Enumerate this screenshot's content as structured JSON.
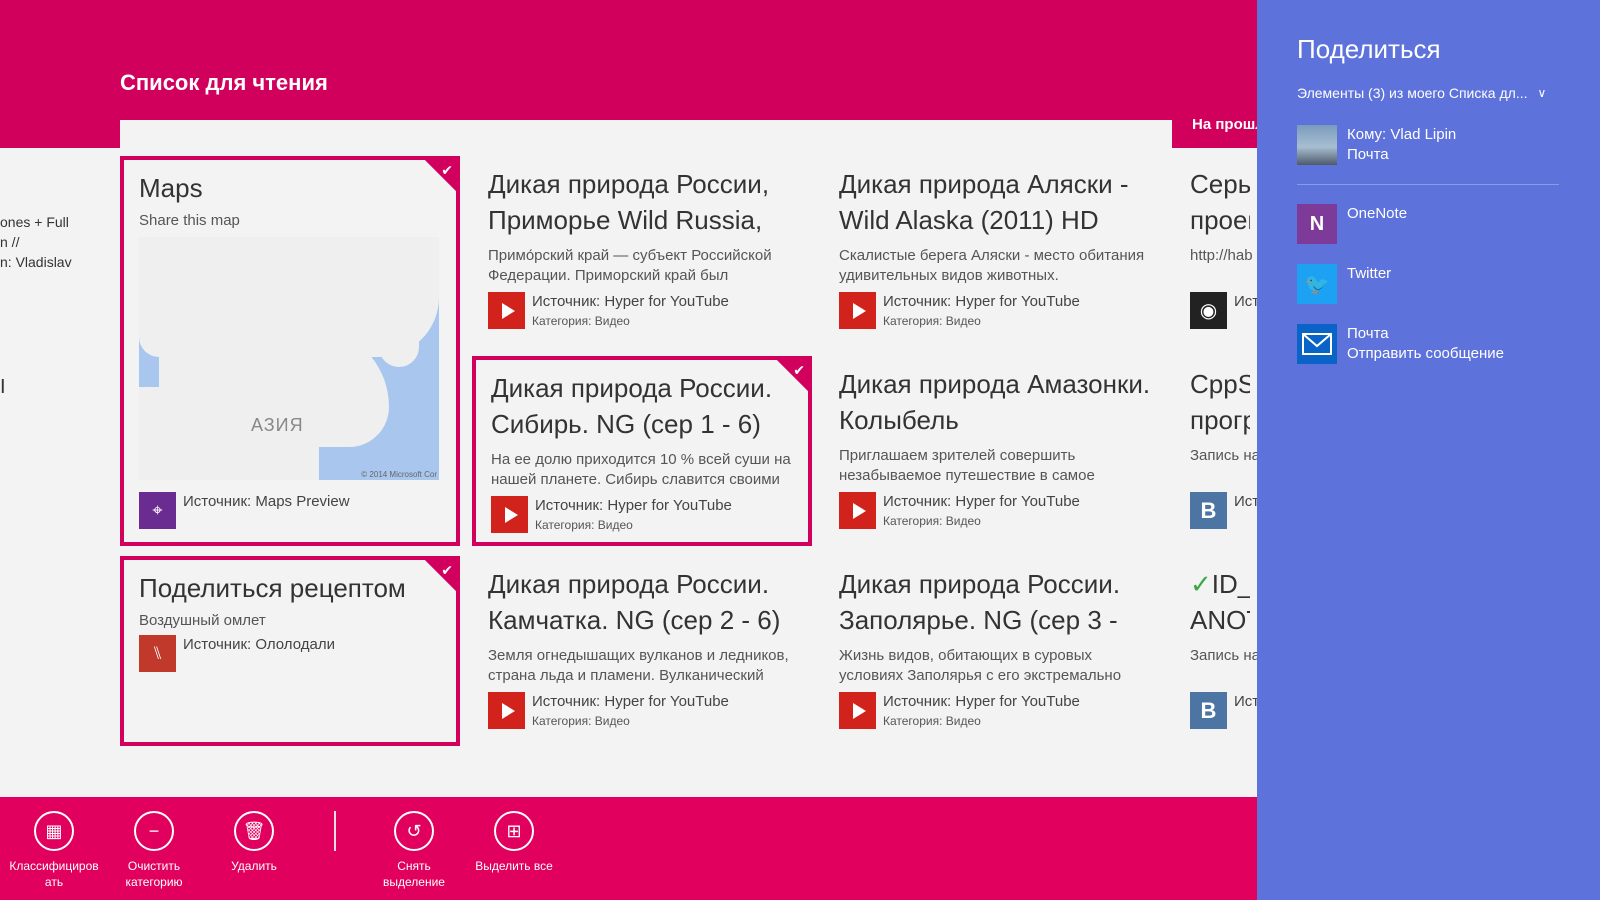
{
  "app": {
    "title": "Список для чтения",
    "section_label": "На прошлой неделе",
    "left_peek": [
      "ones + Full",
      "n //",
      "n: Vladislav"
    ],
    "left_peek_mark": "I"
  },
  "tiles": {
    "maps": {
      "title": "Maps",
      "subtitle": "Share this map",
      "map_label": "АЗИЯ",
      "map_copyright": "© 2014 Microsoft Cor",
      "source": "Источник: Maps Preview"
    },
    "recipe": {
      "title": "Поделиться рецептом",
      "subtitle": "Воздушный омлет",
      "source": "Источник: Ололодали"
    },
    "primorye": {
      "title": "Дикая природа России, Приморье  Wild Russia,",
      "desc": "Примо́рский край — субъект Российской Федерации. Приморский край был",
      "source": "Источник: Hyper for YouTube",
      "category": "Категория: Видео"
    },
    "siberia": {
      "title": "Дикая природа России. Сибирь. NG (сер 1 - 6)",
      "desc": "На ее долю приходится 10 % всей суши на нашей планете. Сибирь славится своими",
      "source": "Источник: Hyper for YouTube",
      "category": "Категория: Видео"
    },
    "kamchatka": {
      "title": "Дикая природа России. Камчатка. NG (сер 2 - 6)",
      "desc": "Земля огнедышащих вулканов и ледников, страна льда и пламени. Вулканический",
      "source": "Источник: Hyper for YouTube",
      "category": "Категория: Видео"
    },
    "alaska": {
      "title": "Дикая природа Аляски - Wild Alaska (2011) HD",
      "desc": "Скалистые берега Аляски - место обитания удивительных видов животных.",
      "source": "Источник: Hyper for YouTube",
      "category": "Категория: Видео"
    },
    "amazon": {
      "title": "Дикая природа Амазонки. Колыбель",
      "desc": "Приглашаем зрителей совершить незабываемое путешествие в самое",
      "source": "Источник: Hyper for YouTube",
      "category": "Категория: Видео"
    },
    "arctic": {
      "title": "Дикая природа России. Заполярье. NG (сер 3 -",
      "desc": "Жизнь видов, обитающих в суровых условиях Заполярья с его экстремально",
      "source": "Источник: Hyper for YouTube",
      "category": "Категория: Видео"
    },
    "series": {
      "title": "Серье проек",
      "desc": "http://hab",
      "source": "Ист"
    },
    "cppst": {
      "title": "CppSt прогр",
      "desc": "Запись на",
      "source": "Ист"
    },
    "idz": {
      "title_check": "✓",
      "title": "ID_Z ANOT",
      "desc": "Запись на",
      "source": "Ист"
    }
  },
  "appbar": {
    "classify": "Классифицировать",
    "clear_category": "Очистить категорию",
    "delete": "Удалить",
    "deselect": "Снять выделение",
    "select_all": "Выделить все"
  },
  "share": {
    "title": "Поделиться",
    "subtitle": "Элементы (3) из моего Списка дл...",
    "contact_line1": "Кому: Vlad Lipin",
    "contact_line2": "Почта",
    "onenote": "OneNote",
    "twitter": "Twitter",
    "mail_line1": "Почта",
    "mail_line2": "Отправить сообщение"
  },
  "colors": {
    "accent": "#d1005d",
    "appbar": "#e1005d",
    "charm": "#5d72db"
  }
}
